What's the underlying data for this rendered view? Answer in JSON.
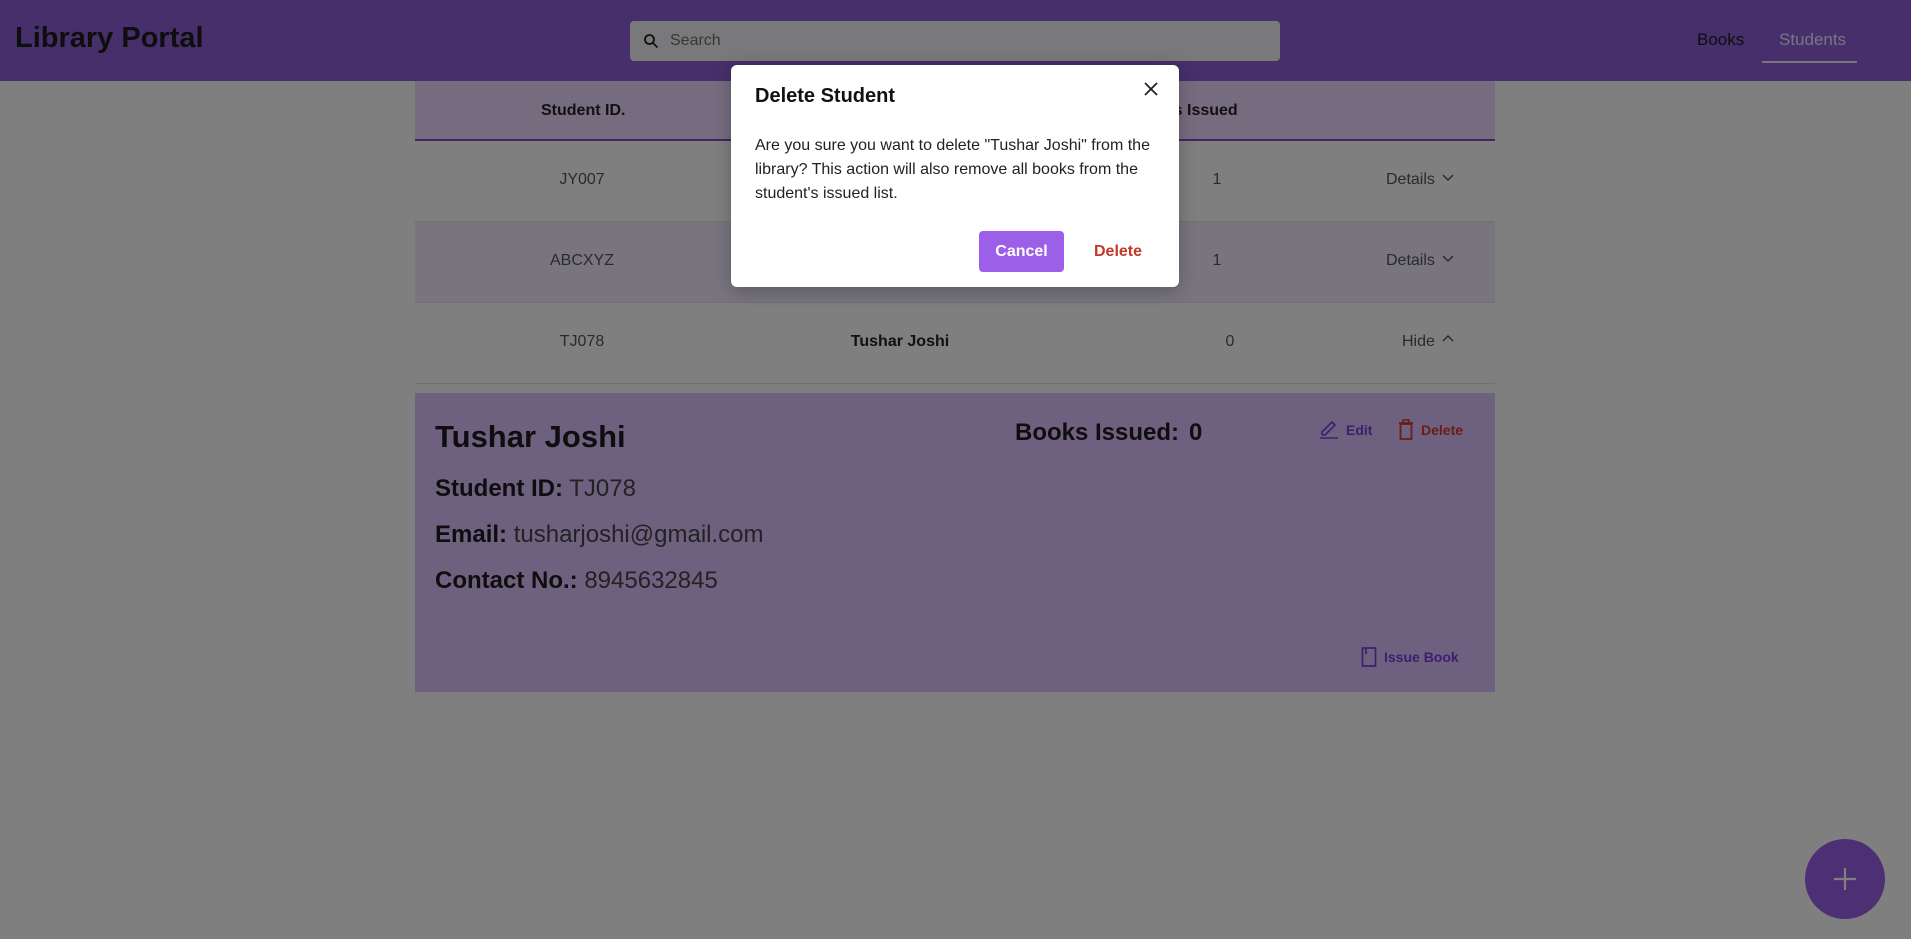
{
  "header": {
    "app_title": "Library Portal",
    "search_placeholder": "Search",
    "nav": {
      "books": "Books",
      "students": "Students"
    }
  },
  "table": {
    "columns": {
      "student_id": "Student ID.",
      "books_issued": "oks Issued"
    },
    "rows": [
      {
        "id": "JY007",
        "books_issued": "1",
        "action": "Details"
      },
      {
        "id": "ABCXYZ",
        "books_issued": "1",
        "action": "Details"
      },
      {
        "id": "TJ078",
        "name": "Tushar Joshi",
        "books_issued": "0",
        "action": "Hide"
      }
    ]
  },
  "details": {
    "name": "Tushar Joshi",
    "student_id_label": "Student ID:",
    "student_id": "TJ078",
    "email_label": "Email:",
    "email": "tusharjoshi@gmail.com",
    "contact_label": "Contact No.:",
    "contact": "8945632845",
    "books_issued_label": "Books Issued:",
    "books_issued": "0",
    "edit_label": "Edit",
    "delete_label": "Delete",
    "issue_book_label": "Issue Book"
  },
  "modal": {
    "title": "Delete Student",
    "message": "Are you sure you want to delete \"Tushar Joshi\" from the library? This action will also remove all books from the student's issued list.",
    "cancel_label": "Cancel",
    "delete_label": "Delete"
  },
  "colors": {
    "accent": "#9b5fe8",
    "header": "#8e5fd6",
    "danger": "#c0392b"
  },
  "icons": {
    "search": "search-icon",
    "close": "close-icon",
    "chevron_down": "chevron-down-icon",
    "chevron_up": "chevron-up-icon",
    "edit": "pencil-icon",
    "delete": "trash-icon",
    "issue_book": "book-icon",
    "add": "plus-icon"
  }
}
